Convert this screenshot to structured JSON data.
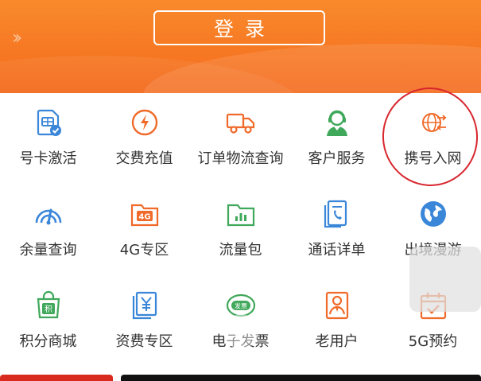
{
  "header": {
    "login_label": "登录",
    "accent_color": "#f46a1c"
  },
  "services": [
    {
      "label": "号卡激活",
      "icon": "sim-card-check-icon",
      "color": "#3a86d8"
    },
    {
      "label": "交费充值",
      "icon": "lightning-circle-icon",
      "color": "#f06a2a"
    },
    {
      "label": "订单物流查询",
      "icon": "delivery-truck-icon",
      "color": "#f06a2a"
    },
    {
      "label": "客户服务",
      "icon": "customer-service-agent-icon",
      "color": "#3fa85a"
    },
    {
      "label": "携号入网",
      "icon": "globe-transfer-icon",
      "color": "#f06a2a"
    },
    {
      "label": "余量查询",
      "icon": "signal-gauge-icon",
      "color": "#3a86d8"
    },
    {
      "label": "4G专区",
      "icon": "folder-4g-icon",
      "color": "#f06a2a"
    },
    {
      "label": "流量包",
      "icon": "folder-chart-icon",
      "color": "#3fa85a"
    },
    {
      "label": "通话详单",
      "icon": "phone-bill-icon",
      "color": "#3a86d8"
    },
    {
      "label": "出境漫游",
      "icon": "earth-icon",
      "color": "#3a86d8"
    },
    {
      "label": "积分商城",
      "icon": "shopping-bag-points-icon",
      "color": "#3fa85a"
    },
    {
      "label": "资费专区",
      "icon": "yuan-card-icon",
      "color": "#3a86d8"
    },
    {
      "label": "电子发票",
      "icon": "invoice-icon",
      "color": "#3fa85a"
    },
    {
      "label": "老用户",
      "icon": "veteran-user-icon",
      "color": "#f06a2a"
    },
    {
      "label": "5G预约",
      "icon": "calendar-check-icon",
      "color": "#f06a2a"
    }
  ]
}
